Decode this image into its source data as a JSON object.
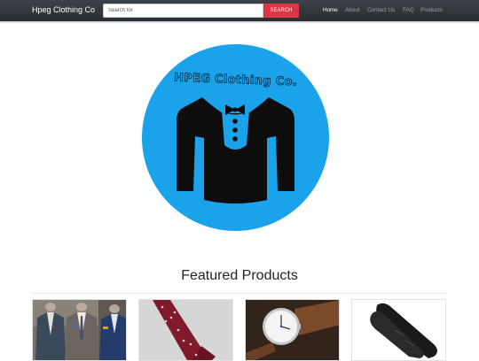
{
  "navbar": {
    "brand": "Hpeg Clothing Co",
    "search": {
      "placeholder": "Search for",
      "value": "",
      "button_label": "SEARCH"
    },
    "links": [
      {
        "label": "Home",
        "active": true
      },
      {
        "label": "About",
        "active": false
      },
      {
        "label": "Contact Us",
        "active": false
      },
      {
        "label": "FAQ",
        "active": false
      },
      {
        "label": "Products",
        "active": false
      }
    ]
  },
  "hero": {
    "logo_text": "HPEG Clothing Co.",
    "logo_icon": "tuxedo-shirt-icon",
    "logo_color": "#1aa3ea"
  },
  "featured": {
    "title": "Featured Products",
    "products": [
      {
        "image": "suits-on-mannequins"
      },
      {
        "image": "burgundy-patterned-tie"
      },
      {
        "image": "wrist-watch"
      },
      {
        "image": "black-gloves"
      }
    ]
  },
  "colors": {
    "navbar_bg": "#2f3337",
    "search_button": "#dc3545",
    "accent_blue": "#1aa3ea"
  }
}
